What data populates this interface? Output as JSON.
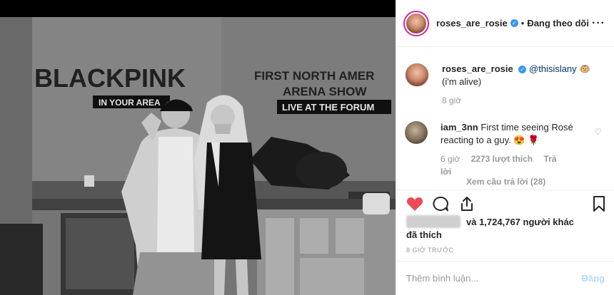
{
  "photo": {
    "sign_left": "BLACKPINK",
    "sign_left_sub": "IN YOUR AREA",
    "sign_right_line1": "FIRST NORTH AMER",
    "sign_right_line2": "ARENA SHOW",
    "sign_right_sub": "LIVE AT THE FORUM"
  },
  "header": {
    "username": "roses_are_rosie",
    "separator": "•",
    "follow_status": "Đang theo dõi",
    "more": "···"
  },
  "caption": {
    "username": "roses_are_rosie",
    "mention": "@thisislany",
    "emoji": "🐵",
    "text": "(i'm alive)",
    "time": "8 giờ"
  },
  "comment": {
    "username": "iam_3nn",
    "text": "First time seeing Rosé reacting to a guy. 😍 🌹",
    "time": "6 giờ",
    "likes": "2273 lượt thích",
    "reply": "Trả lời",
    "view_replies": "Xem câu trả lời (28)"
  },
  "likes": {
    "text": "và 1,724,767 người khác",
    "text2": "đã thích"
  },
  "timestamp": "8 GIỜ TRƯỚC",
  "add_comment": {
    "placeholder": "Thêm bình luận...",
    "post": "Đăng"
  },
  "colors": {
    "heart": "#ed4956",
    "verified": "#3897f0"
  }
}
